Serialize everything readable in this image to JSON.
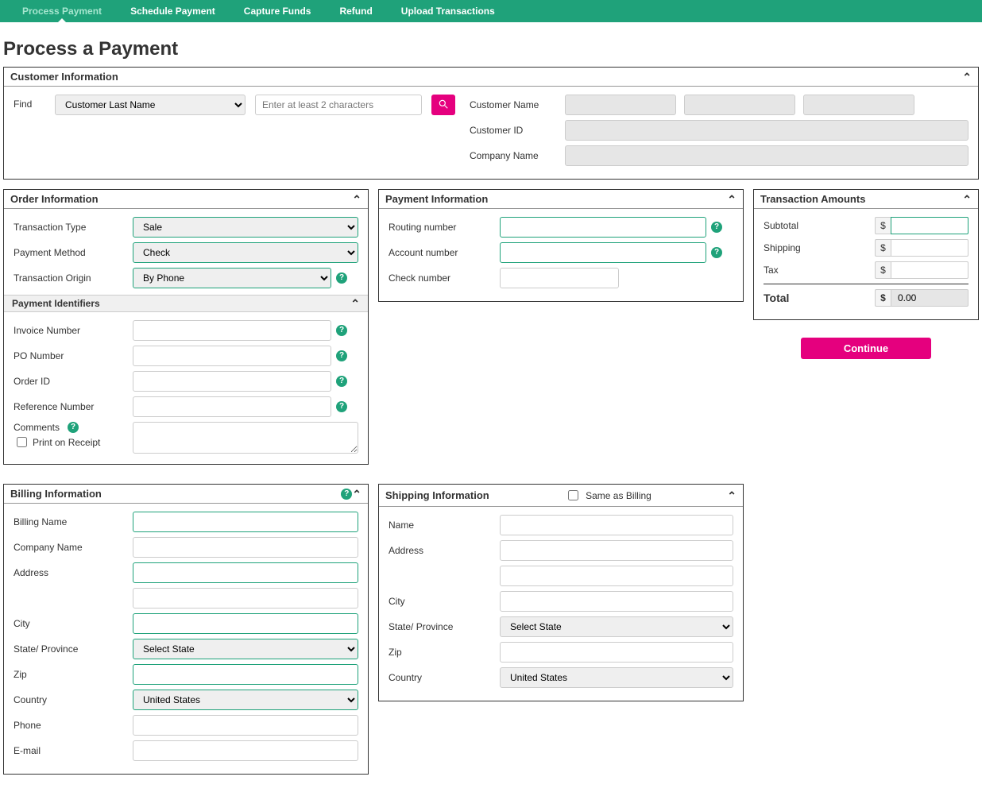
{
  "nav": {
    "items": [
      {
        "label": "Process Payment",
        "active": true
      },
      {
        "label": "Schedule Payment"
      },
      {
        "label": "Capture Funds"
      },
      {
        "label": "Refund"
      },
      {
        "label": "Upload Transactions"
      }
    ]
  },
  "page_title": "Process a Payment",
  "customer": {
    "title": "Customer Information",
    "find_label": "Find",
    "find_by_selected": "Customer Last Name",
    "search_placeholder": "Enter at least 2 characters",
    "name_label": "Customer Name",
    "id_label": "Customer ID",
    "company_label": "Company Name"
  },
  "order": {
    "title": "Order Information",
    "transaction_type_label": "Transaction Type",
    "transaction_type_value": "Sale",
    "payment_method_label": "Payment Method",
    "payment_method_value": "Check",
    "transaction_origin_label": "Transaction Origin",
    "transaction_origin_value": "By Phone",
    "identifiers_title": "Payment Identifiers",
    "invoice_label": "Invoice Number",
    "po_label": "PO Number",
    "orderid_label": "Order ID",
    "reference_label": "Reference Number",
    "comments_label": "Comments",
    "print_receipt_label": "Print on Receipt"
  },
  "payment": {
    "title": "Payment Information",
    "routing_label": "Routing number",
    "account_label": "Account number",
    "check_label": "Check number"
  },
  "amounts": {
    "title": "Transaction Amounts",
    "subtotal_label": "Subtotal",
    "shipping_label": "Shipping",
    "tax_label": "Tax",
    "total_label": "Total",
    "total_value": "0.00",
    "currency": "$"
  },
  "continue_label": "Continue",
  "billing": {
    "title": "Billing Information",
    "name_label": "Billing Name",
    "company_label": "Company Name",
    "address_label": "Address",
    "city_label": "City",
    "state_label": "State/ Province",
    "state_value": "Select State",
    "zip_label": "Zip",
    "country_label": "Country",
    "country_value": "United States",
    "phone_label": "Phone",
    "email_label": "E-mail"
  },
  "shipping": {
    "title": "Shipping Information",
    "same_as_billing_label": "Same as Billing",
    "name_label": "Name",
    "address_label": "Address",
    "city_label": "City",
    "state_label": "State/ Province",
    "state_value": "Select State",
    "zip_label": "Zip",
    "country_label": "Country",
    "country_value": "United States"
  }
}
